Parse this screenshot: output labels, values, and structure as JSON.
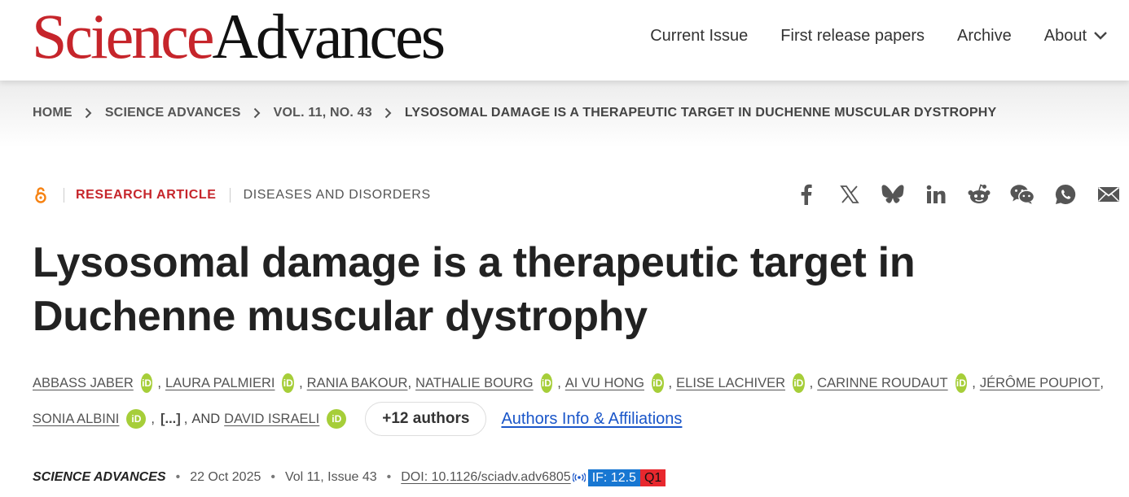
{
  "header": {
    "logo_part1": "Science",
    "logo_part2": "Advances",
    "nav": [
      "Current Issue",
      "First release papers",
      "Archive",
      "About"
    ]
  },
  "breadcrumb": [
    "HOME",
    "SCIENCE ADVANCES",
    "VOL. 11, NO. 43",
    "LYSOSOMAL DAMAGE IS A THERAPEUTIC TARGET IN DUCHENNE MUSCULAR DYSTROPHY"
  ],
  "meta": {
    "article_type": "RESEARCH ARTICLE",
    "subject": "DISEASES AND DISORDERS",
    "share_icons": [
      "facebook-icon",
      "x-icon",
      "bluesky-icon",
      "linkedin-icon",
      "reddit-icon",
      "wechat-icon",
      "whatsapp-icon",
      "email-icon"
    ]
  },
  "title": "Lysosomal damage is a therapeutic target in Duchenne muscular dystrophy",
  "authors": {
    "names": [
      "ABBASS JABER",
      "LAURA PALMIERI",
      "RANIA BAKOUR",
      "NATHALIE BOURG",
      "AI VU HONG",
      "ELISE LACHIVER",
      "CARINNE ROUDAUT",
      "JÉRÔME POUPIOT",
      "SONIA ALBINI",
      "DAVID ISRAELI"
    ],
    "ellipsis": "[...]",
    "and": "AND",
    "more": "+12 authors",
    "affiliations_link": "Authors Info & Affiliations",
    "orcid_label": "iD"
  },
  "pub": {
    "journal": "SCIENCE ADVANCES",
    "date": "22 Oct 2025",
    "volume": "Vol 11, Issue 43",
    "doi": "DOI: 10.1126/sciadv.adv6805",
    "if_badge": "IF: 12.5",
    "quartile": "Q1"
  },
  "colors": {
    "brand_red": "#c6252b",
    "link_blue": "#1a56c9",
    "orcid_green": "#a6ce39",
    "if_blue": "#1877d2",
    "q_red": "#e8282e"
  }
}
